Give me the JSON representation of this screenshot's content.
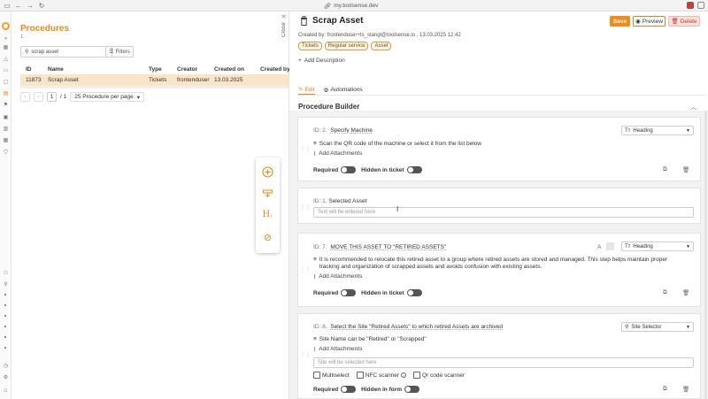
{
  "browser": {
    "url": "my.toolsense.dev"
  },
  "left": {
    "title": "Procedures",
    "count": "1",
    "search_value": "scrap asset",
    "filters_label": "Filters",
    "columns": [
      "ID",
      "Name",
      "Type",
      "Creator",
      "Created on",
      "Created by"
    ],
    "rows": [
      {
        "id": "11873",
        "name": "Scrap Asset",
        "type": "Tickets",
        "creator": "frontenduser",
        "created_on": "13.03.2025"
      }
    ],
    "page": "1",
    "page_total": "/ 1",
    "per_page": "25 Procedure per page",
    "close_label": "Close"
  },
  "right": {
    "title": "Scrap Asset",
    "save_label": "Save",
    "preview_label": "Preview",
    "delete_label": "Delete",
    "created_by": "Created by: frontenduser+ts_stangl@toolsense.io , 13.03.2025 12:42",
    "tags": [
      "Tickets",
      "Regular service",
      "Asset"
    ],
    "add_description": "Add Description",
    "tabs": [
      {
        "label": "Edit",
        "active": true
      },
      {
        "label": "Automations",
        "active": false
      }
    ],
    "builder_title": "Procedure Builder",
    "steps": [
      {
        "id_label": "ID: 2.",
        "title": "Specify Machine",
        "type": "Heading",
        "instruction": "Scan the QR code of the machine or select it from the list below",
        "attachments": "Add Attachments",
        "required_label": "Required",
        "hidden_label": "Hidden in ticket"
      },
      {
        "id_label": "ID: 1.",
        "title": "Selected Asset",
        "placeholder": "Text will be entered here"
      },
      {
        "id_label": "ID: 7.",
        "title": "MOVE THIS ASSET TO \"RETIRED ASSETS\"",
        "type": "Heading",
        "instruction": "It is recommended to relocate this retired asset to a group where retired assets are stored and managed. This step helps maintain proper tracking and organization of scrapped assets and avoids confusion with existing assets.",
        "attachments": "Add Attachments",
        "required_label": "Required",
        "hidden_label": "Hidden in ticket"
      },
      {
        "id_label": "ID: 8.",
        "title": "Select the Site \"Retired Assets\" to which retired Assets are archived",
        "type": "Site Selector",
        "instruction": "Site Name can be \"Retired\" or \"Scrapped\"",
        "attachments": "Add Attachments",
        "placeholder": "Site will be selected here",
        "checkboxes": [
          "Multiselect",
          "NFC scanner",
          "Qr code scanner"
        ],
        "required_label": "Required",
        "hidden_label": "Hidden in form"
      }
    ]
  },
  "colors": {
    "accent": "#e8891a",
    "selected_row": "#fbe5c8"
  }
}
